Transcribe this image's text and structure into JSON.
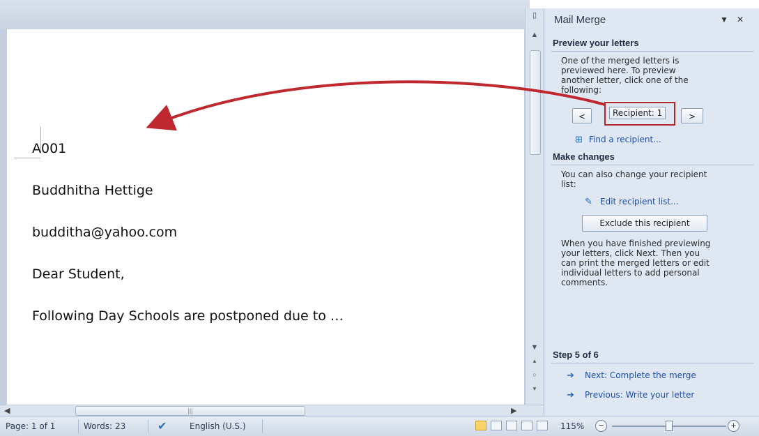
{
  "document": {
    "lines": [
      "A001",
      "Buddhitha Hettige",
      "budditha@yahoo.com",
      "Dear Student,",
      "Following Day Schools are postponed due to …"
    ]
  },
  "pane": {
    "title": "Mail Merge",
    "preview": {
      "heading": "Preview your letters",
      "text": [
        "One of the merged letters is",
        "previewed here. To preview",
        "another letter, click one of the",
        "following:"
      ],
      "prev_label": "<",
      "recipient_label": "Recipient: 1",
      "next_label": ">",
      "find_link": "Find a recipient..."
    },
    "changes": {
      "heading": "Make changes",
      "text": [
        "You can also change your recipient",
        "list:"
      ],
      "edit_link": "Edit recipient list...",
      "exclude_label": "Exclude this recipient",
      "note": [
        "When you have finished previewing",
        "your letters, click Next. Then you",
        "can print the merged letters or edit",
        "individual letters to add personal",
        "comments."
      ]
    },
    "step": {
      "heading": "Step 5 of 6",
      "next_link": "Next: Complete the merge",
      "previous_link": "Previous: Write your letter"
    }
  },
  "statusbar": {
    "page": "Page: 1 of 1",
    "words": "Words: 23",
    "language": "English (U.S.)",
    "zoom": "115%",
    "zoom_level": 0.5
  },
  "colors": {
    "highlight": "#b3262b",
    "link": "#1f4ea8",
    "pane_bg": "#dfe7f2"
  },
  "icons": [
    "proofing-icon",
    "find-recipient-icon",
    "edit-list-icon",
    "arrow-right-icon",
    "arrow-left-icon"
  ]
}
